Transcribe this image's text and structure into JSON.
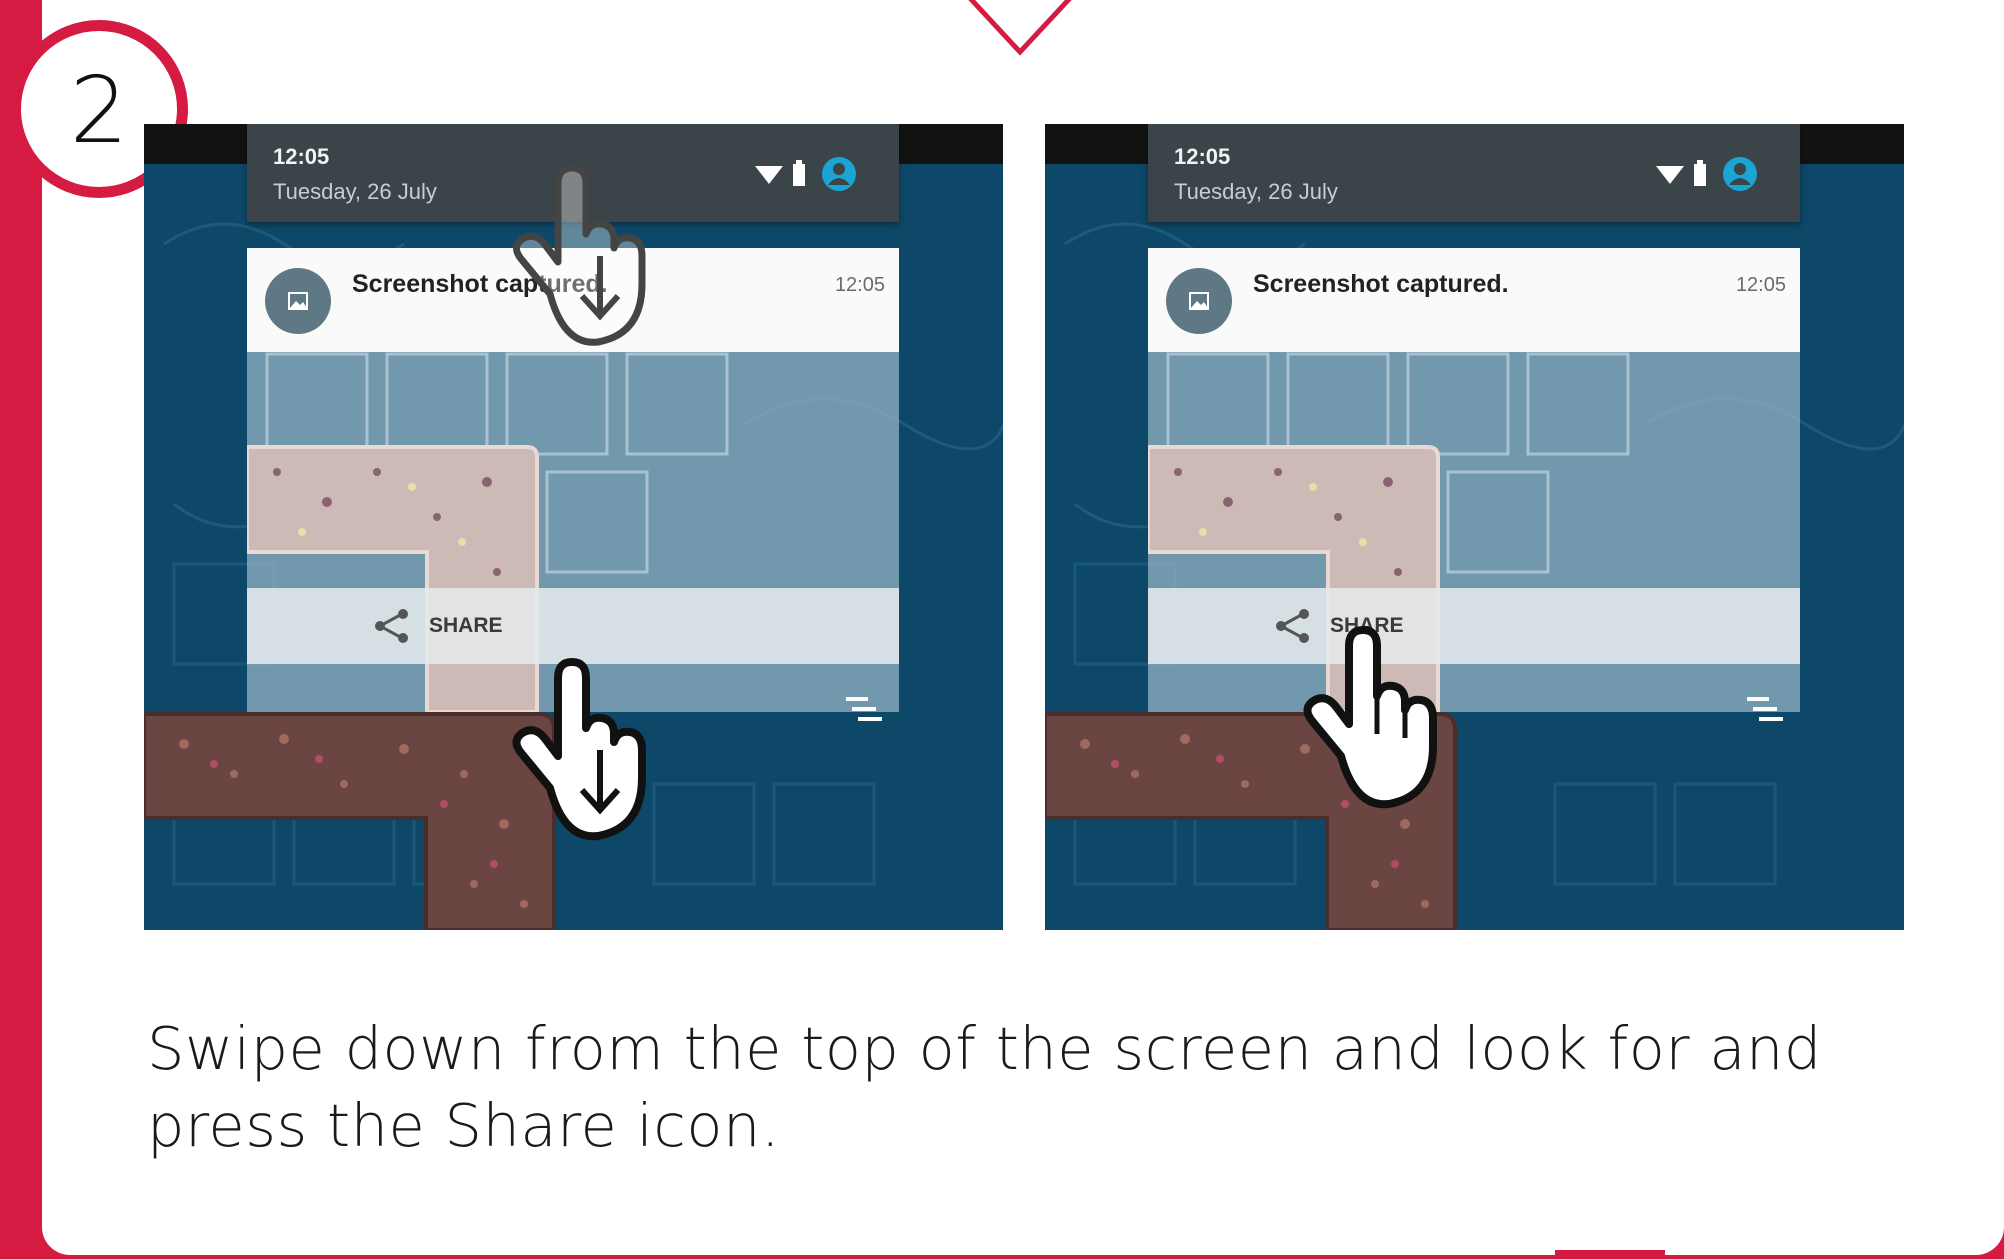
{
  "step": {
    "number": "2"
  },
  "colors": {
    "brand_red": "#d61b42",
    "card": "#ffffff",
    "phone_bg": "#0d4868",
    "status_bar": "#3b4448",
    "icon_accent": "#1aa5d4"
  },
  "screens": [
    {
      "status": {
        "time": "12:05",
        "date": "Tuesday, 26 July",
        "icons": [
          "wifi-icon",
          "battery-icon",
          "account-icon"
        ]
      },
      "notification": {
        "title": "Screenshot captured.",
        "time": "12:05",
        "icon": "image-icon"
      },
      "action": {
        "label": "SHARE",
        "icon": "share-icon"
      },
      "gestures": [
        "swipe-down-hand-icon",
        "swipe-down-hand-icon"
      ]
    },
    {
      "status": {
        "time": "12:05",
        "date": "Tuesday, 26 July",
        "icons": [
          "wifi-icon",
          "battery-icon",
          "account-icon"
        ]
      },
      "notification": {
        "title": "Screenshot captured.",
        "time": "12:05",
        "icon": "image-icon"
      },
      "action": {
        "label": "SHARE",
        "icon": "share-icon"
      },
      "gestures": [
        "tap-hand-icon"
      ]
    }
  ],
  "caption": "Swipe down from the top of the screen and look for and press the Share icon."
}
